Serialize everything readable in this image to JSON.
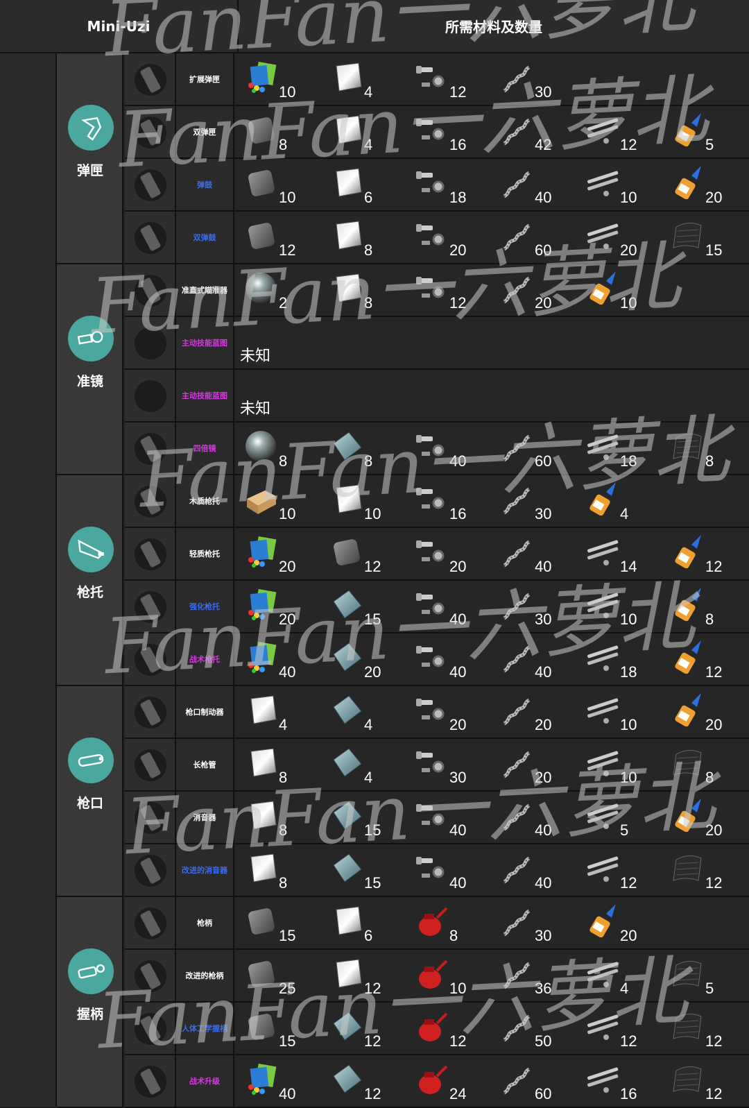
{
  "header": {
    "weapon": "Mini-Uzi",
    "materials_title": "所需材料及数量"
  },
  "colors": {
    "teal": "#4aa8a0",
    "white_text": "#ffffff",
    "blue_text": "#3a6cf0",
    "purple_text": "#d33be0"
  },
  "categories": [
    {
      "name": "弹匣",
      "icon": "magazine-icon",
      "rows": 4
    },
    {
      "name": "准镜",
      "icon": "scope-icon",
      "rows": 4
    },
    {
      "name": "枪托",
      "icon": "stock-icon",
      "rows": 4
    },
    {
      "name": "枪口",
      "icon": "muzzle-icon",
      "rows": 4
    },
    {
      "name": "握柄",
      "icon": "grip-icon",
      "rows": 4
    }
  ],
  "rows": [
    {
      "name": "扩展弹匣",
      "rarity": "white",
      "mats": [
        [
          "parts",
          10
        ],
        [
          "steel",
          4
        ],
        [
          "bolts",
          12
        ],
        [
          "spring",
          30
        ]
      ]
    },
    {
      "name": "双弹匣",
      "rarity": "white",
      "mats": [
        [
          "iron",
          8
        ],
        [
          "steel",
          4
        ],
        [
          "bolts",
          16
        ],
        [
          "spring",
          42
        ],
        [
          "tubes",
          12
        ],
        [
          "glue",
          5
        ]
      ]
    },
    {
      "name": "弹鼓",
      "rarity": "blue",
      "mats": [
        [
          "iron",
          10
        ],
        [
          "steel",
          6
        ],
        [
          "bolts",
          18
        ],
        [
          "spring",
          40
        ],
        [
          "tubes",
          10
        ],
        [
          "glue",
          20
        ]
      ]
    },
    {
      "name": "双弹鼓",
      "rarity": "blue",
      "mats": [
        [
          "iron",
          12
        ],
        [
          "steel",
          8
        ],
        [
          "bolts",
          20
        ],
        [
          "spring",
          60
        ],
        [
          "tubes",
          20
        ],
        [
          "carbon",
          15
        ]
      ]
    },
    {
      "name": "准直式瞄准器",
      "rarity": "white",
      "mats": [
        [
          "lens",
          2
        ],
        [
          "steel",
          8
        ],
        [
          "bolts",
          12
        ],
        [
          "spring",
          20
        ],
        [
          "glue",
          10
        ]
      ]
    },
    {
      "name": "主动技能蓝图",
      "rarity": "purple",
      "unknown": "未知"
    },
    {
      "name": "主动技能蓝图",
      "rarity": "purple",
      "unknown": "未知"
    },
    {
      "name": "四倍镜",
      "rarity": "purple",
      "mats": [
        [
          "lens",
          8
        ],
        [
          "glass",
          8
        ],
        [
          "bolts",
          40
        ],
        [
          "spring",
          60
        ],
        [
          "tubes",
          18
        ],
        [
          "carbon",
          8
        ]
      ]
    },
    {
      "name": "木质枪托",
      "rarity": "white",
      "mats": [
        [
          "wood",
          10
        ],
        [
          "steel",
          10
        ],
        [
          "bolts",
          16
        ],
        [
          "spring",
          30
        ],
        [
          "glue",
          4
        ]
      ]
    },
    {
      "name": "轻质枪托",
      "rarity": "white",
      "mats": [
        [
          "parts",
          20
        ],
        [
          "iron",
          12
        ],
        [
          "bolts",
          20
        ],
        [
          "spring",
          40
        ],
        [
          "tubes",
          14
        ],
        [
          "glue",
          12
        ]
      ]
    },
    {
      "name": "强化枪托",
      "rarity": "blue",
      "mats": [
        [
          "parts",
          20
        ],
        [
          "glass",
          15
        ],
        [
          "bolts",
          40
        ],
        [
          "spring",
          30
        ],
        [
          "tubes",
          10
        ],
        [
          "glue",
          8
        ]
      ]
    },
    {
      "name": "战术枪托",
      "rarity": "purple",
      "mats": [
        [
          "parts",
          40
        ],
        [
          "glass",
          20
        ],
        [
          "bolts",
          40
        ],
        [
          "spring",
          40
        ],
        [
          "tubes",
          18
        ],
        [
          "glue",
          12
        ]
      ]
    },
    {
      "name": "枪口制动器",
      "rarity": "white",
      "mats": [
        [
          "steel",
          4
        ],
        [
          "glass",
          4
        ],
        [
          "bolts",
          20
        ],
        [
          "spring",
          20
        ],
        [
          "tubes",
          10
        ],
        [
          "glue",
          20
        ]
      ]
    },
    {
      "name": "长枪管",
      "rarity": "white",
      "mats": [
        [
          "steel",
          8
        ],
        [
          "glass",
          4
        ],
        [
          "bolts",
          30
        ],
        [
          "spring",
          20
        ],
        [
          "tubes",
          10
        ],
        [
          "carbon",
          8
        ]
      ]
    },
    {
      "name": "消音器",
      "rarity": "white",
      "mats": [
        [
          "steel",
          8
        ],
        [
          "glass",
          15
        ],
        [
          "bolts",
          40
        ],
        [
          "spring",
          40
        ],
        [
          "tubes",
          5
        ],
        [
          "glue",
          20
        ]
      ]
    },
    {
      "name": "改进的消音器",
      "rarity": "blue",
      "mats": [
        [
          "steel",
          8
        ],
        [
          "glass",
          15
        ],
        [
          "bolts",
          40
        ],
        [
          "spring",
          40
        ],
        [
          "tubes",
          12
        ],
        [
          "carbon",
          12
        ]
      ]
    },
    {
      "name": "枪柄",
      "rarity": "white",
      "mats": [
        [
          "iron",
          15
        ],
        [
          "steel",
          6
        ],
        [
          "oilcan",
          8
        ],
        [
          "spring",
          30
        ],
        [
          "glue",
          20
        ]
      ]
    },
    {
      "name": "改进的枪柄",
      "rarity": "white",
      "mats": [
        [
          "iron",
          25
        ],
        [
          "steel",
          12
        ],
        [
          "oilcan",
          10
        ],
        [
          "spring",
          36
        ],
        [
          "tubes",
          4
        ],
        [
          "carbon",
          5
        ]
      ]
    },
    {
      "name": "人体工学握柄",
      "rarity": "blue",
      "mats": [
        [
          "iron",
          15
        ],
        [
          "glass",
          12
        ],
        [
          "oilcan",
          12
        ],
        [
          "spring",
          50
        ],
        [
          "tubes",
          12
        ],
        [
          "carbon",
          12
        ]
      ]
    },
    {
      "name": "战术升级",
      "rarity": "purple",
      "mats": [
        [
          "parts",
          40
        ],
        [
          "glass",
          12
        ],
        [
          "oilcan",
          24
        ],
        [
          "spring",
          60
        ],
        [
          "tubes",
          16
        ],
        [
          "carbon",
          12
        ]
      ]
    }
  ],
  "watermark": "FanFan一六萝北"
}
